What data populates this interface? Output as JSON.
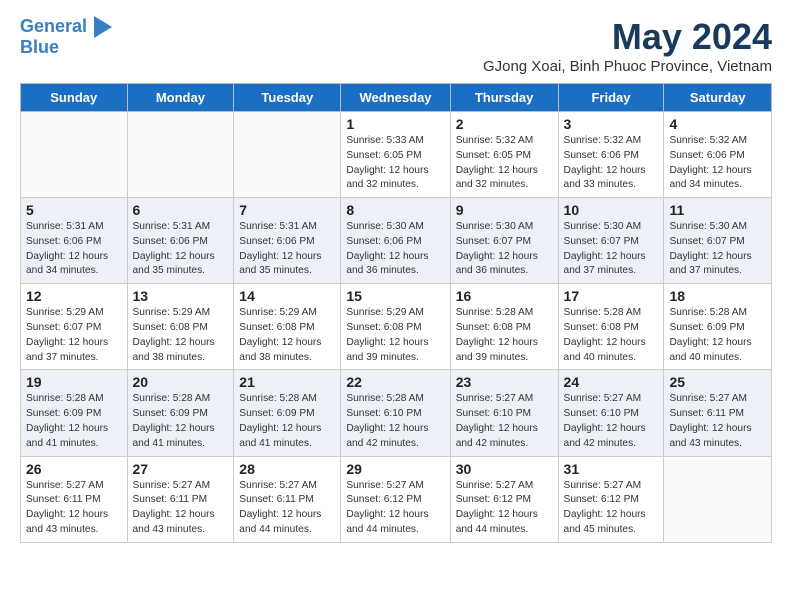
{
  "header": {
    "logo_line1": "General",
    "logo_line2": "Blue",
    "main_title": "May 2024",
    "subtitle": "GJong Xoai, Binh Phuoc Province, Vietnam"
  },
  "days_of_week": [
    "Sunday",
    "Monday",
    "Tuesday",
    "Wednesday",
    "Thursday",
    "Friday",
    "Saturday"
  ],
  "weeks": [
    [
      {
        "day": "",
        "info": ""
      },
      {
        "day": "",
        "info": ""
      },
      {
        "day": "",
        "info": ""
      },
      {
        "day": "1",
        "info": "Sunrise: 5:33 AM\nSunset: 6:05 PM\nDaylight: 12 hours\nand 32 minutes."
      },
      {
        "day": "2",
        "info": "Sunrise: 5:32 AM\nSunset: 6:05 PM\nDaylight: 12 hours\nand 32 minutes."
      },
      {
        "day": "3",
        "info": "Sunrise: 5:32 AM\nSunset: 6:06 PM\nDaylight: 12 hours\nand 33 minutes."
      },
      {
        "day": "4",
        "info": "Sunrise: 5:32 AM\nSunset: 6:06 PM\nDaylight: 12 hours\nand 34 minutes."
      }
    ],
    [
      {
        "day": "5",
        "info": "Sunrise: 5:31 AM\nSunset: 6:06 PM\nDaylight: 12 hours\nand 34 minutes."
      },
      {
        "day": "6",
        "info": "Sunrise: 5:31 AM\nSunset: 6:06 PM\nDaylight: 12 hours\nand 35 minutes."
      },
      {
        "day": "7",
        "info": "Sunrise: 5:31 AM\nSunset: 6:06 PM\nDaylight: 12 hours\nand 35 minutes."
      },
      {
        "day": "8",
        "info": "Sunrise: 5:30 AM\nSunset: 6:06 PM\nDaylight: 12 hours\nand 36 minutes."
      },
      {
        "day": "9",
        "info": "Sunrise: 5:30 AM\nSunset: 6:07 PM\nDaylight: 12 hours\nand 36 minutes."
      },
      {
        "day": "10",
        "info": "Sunrise: 5:30 AM\nSunset: 6:07 PM\nDaylight: 12 hours\nand 37 minutes."
      },
      {
        "day": "11",
        "info": "Sunrise: 5:30 AM\nSunset: 6:07 PM\nDaylight: 12 hours\nand 37 minutes."
      }
    ],
    [
      {
        "day": "12",
        "info": "Sunrise: 5:29 AM\nSunset: 6:07 PM\nDaylight: 12 hours\nand 37 minutes."
      },
      {
        "day": "13",
        "info": "Sunrise: 5:29 AM\nSunset: 6:08 PM\nDaylight: 12 hours\nand 38 minutes."
      },
      {
        "day": "14",
        "info": "Sunrise: 5:29 AM\nSunset: 6:08 PM\nDaylight: 12 hours\nand 38 minutes."
      },
      {
        "day": "15",
        "info": "Sunrise: 5:29 AM\nSunset: 6:08 PM\nDaylight: 12 hours\nand 39 minutes."
      },
      {
        "day": "16",
        "info": "Sunrise: 5:28 AM\nSunset: 6:08 PM\nDaylight: 12 hours\nand 39 minutes."
      },
      {
        "day": "17",
        "info": "Sunrise: 5:28 AM\nSunset: 6:08 PM\nDaylight: 12 hours\nand 40 minutes."
      },
      {
        "day": "18",
        "info": "Sunrise: 5:28 AM\nSunset: 6:09 PM\nDaylight: 12 hours\nand 40 minutes."
      }
    ],
    [
      {
        "day": "19",
        "info": "Sunrise: 5:28 AM\nSunset: 6:09 PM\nDaylight: 12 hours\nand 41 minutes."
      },
      {
        "day": "20",
        "info": "Sunrise: 5:28 AM\nSunset: 6:09 PM\nDaylight: 12 hours\nand 41 minutes."
      },
      {
        "day": "21",
        "info": "Sunrise: 5:28 AM\nSunset: 6:09 PM\nDaylight: 12 hours\nand 41 minutes."
      },
      {
        "day": "22",
        "info": "Sunrise: 5:28 AM\nSunset: 6:10 PM\nDaylight: 12 hours\nand 42 minutes."
      },
      {
        "day": "23",
        "info": "Sunrise: 5:27 AM\nSunset: 6:10 PM\nDaylight: 12 hours\nand 42 minutes."
      },
      {
        "day": "24",
        "info": "Sunrise: 5:27 AM\nSunset: 6:10 PM\nDaylight: 12 hours\nand 42 minutes."
      },
      {
        "day": "25",
        "info": "Sunrise: 5:27 AM\nSunset: 6:11 PM\nDaylight: 12 hours\nand 43 minutes."
      }
    ],
    [
      {
        "day": "26",
        "info": "Sunrise: 5:27 AM\nSunset: 6:11 PM\nDaylight: 12 hours\nand 43 minutes."
      },
      {
        "day": "27",
        "info": "Sunrise: 5:27 AM\nSunset: 6:11 PM\nDaylight: 12 hours\nand 43 minutes."
      },
      {
        "day": "28",
        "info": "Sunrise: 5:27 AM\nSunset: 6:11 PM\nDaylight: 12 hours\nand 44 minutes."
      },
      {
        "day": "29",
        "info": "Sunrise: 5:27 AM\nSunset: 6:12 PM\nDaylight: 12 hours\nand 44 minutes."
      },
      {
        "day": "30",
        "info": "Sunrise: 5:27 AM\nSunset: 6:12 PM\nDaylight: 12 hours\nand 44 minutes."
      },
      {
        "day": "31",
        "info": "Sunrise: 5:27 AM\nSunset: 6:12 PM\nDaylight: 12 hours\nand 45 minutes."
      },
      {
        "day": "",
        "info": ""
      }
    ]
  ]
}
